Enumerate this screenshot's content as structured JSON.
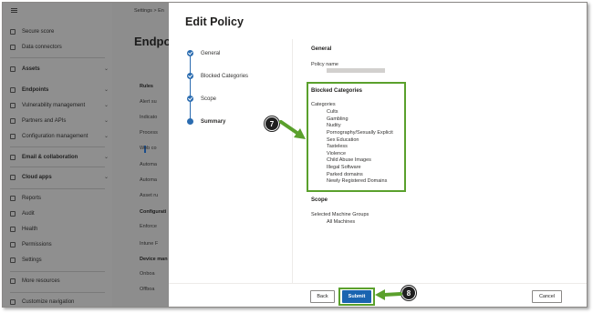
{
  "nav": {
    "items": [
      {
        "label": "Secure score",
        "icon": "trophy-icon",
        "chev": false
      },
      {
        "label": "Data connectors",
        "icon": "connector-icon",
        "chev": false
      },
      {
        "label": "Assets",
        "icon": "assets-icon",
        "chev": true,
        "bold": true
      },
      {
        "label": "Endpoints",
        "icon": "endpoints-icon",
        "chev": true,
        "bold": true
      },
      {
        "label": "Vulnerability management",
        "icon": "vulnerability-icon",
        "chev": true
      },
      {
        "label": "Partners and APIs",
        "icon": "partners-icon",
        "chev": true
      },
      {
        "label": "Configuration management",
        "icon": "configuration-icon",
        "chev": true
      },
      {
        "label": "Email & collaboration",
        "icon": "email-icon",
        "chev": true,
        "bold": true
      },
      {
        "label": "Cloud apps",
        "icon": "cloud-icon",
        "chev": true,
        "bold": true
      },
      {
        "label": "Reports",
        "icon": "reports-icon",
        "chev": false
      },
      {
        "label": "Audit",
        "icon": "audit-icon",
        "chev": false
      },
      {
        "label": "Health",
        "icon": "health-icon",
        "chev": false
      },
      {
        "label": "Permissions",
        "icon": "permissions-icon",
        "chev": false
      },
      {
        "label": "Settings",
        "icon": "gear-icon",
        "chev": false
      },
      {
        "label": "More resources",
        "icon": "info-icon",
        "chev": false
      },
      {
        "label": "Customize navigation",
        "icon": "pencil-icon",
        "chev": false
      }
    ]
  },
  "mid": {
    "breadcrumb": "Settings  >  En",
    "title": "Endpoi",
    "items": [
      {
        "label": "Rules",
        "head": true
      },
      {
        "label": "Alert su"
      },
      {
        "label": "Indicato"
      },
      {
        "label": "Process"
      },
      {
        "label": "Web co"
      },
      {
        "label": "Automa"
      },
      {
        "label": "Automa"
      },
      {
        "label": "Asset ru"
      },
      {
        "label": "Configurati",
        "head": true
      },
      {
        "label": "Enforce"
      },
      {
        "label": "Intune F"
      },
      {
        "label": "Device man",
        "head": true
      },
      {
        "label": "Onboa"
      },
      {
        "label": "Offboa"
      }
    ]
  },
  "panel": {
    "title": "Edit Policy",
    "steps": [
      {
        "label": "General",
        "state": "done"
      },
      {
        "label": "Blocked Categories",
        "state": "done"
      },
      {
        "label": "Scope",
        "state": "done"
      },
      {
        "label": "Summary",
        "state": "current"
      }
    ],
    "general": {
      "heading": "General",
      "policy_name_label": "Policy name"
    },
    "blocked": {
      "heading": "Blocked Categories",
      "categories_label": "Categories",
      "categories": [
        "Cults",
        "Gambling",
        "Nudity",
        "Pornography/Sexually Explicit",
        "Sex Education",
        "Tasteless",
        "Violence",
        "Child Abuse Images",
        "Illegal Software",
        "Parked domains",
        "Newly Registered Domains"
      ]
    },
    "scope": {
      "heading": "Scope",
      "groups_label": "Selected Machine Groups",
      "groups_value": "All Machines"
    },
    "buttons": {
      "back": "Back",
      "submit": "Submit",
      "cancel": "Cancel"
    }
  },
  "callouts": {
    "first": "7",
    "second": "8"
  },
  "colors": {
    "accent": "#1a64b0",
    "highlight": "#5aa02c",
    "callout": "#1f1f1f"
  }
}
